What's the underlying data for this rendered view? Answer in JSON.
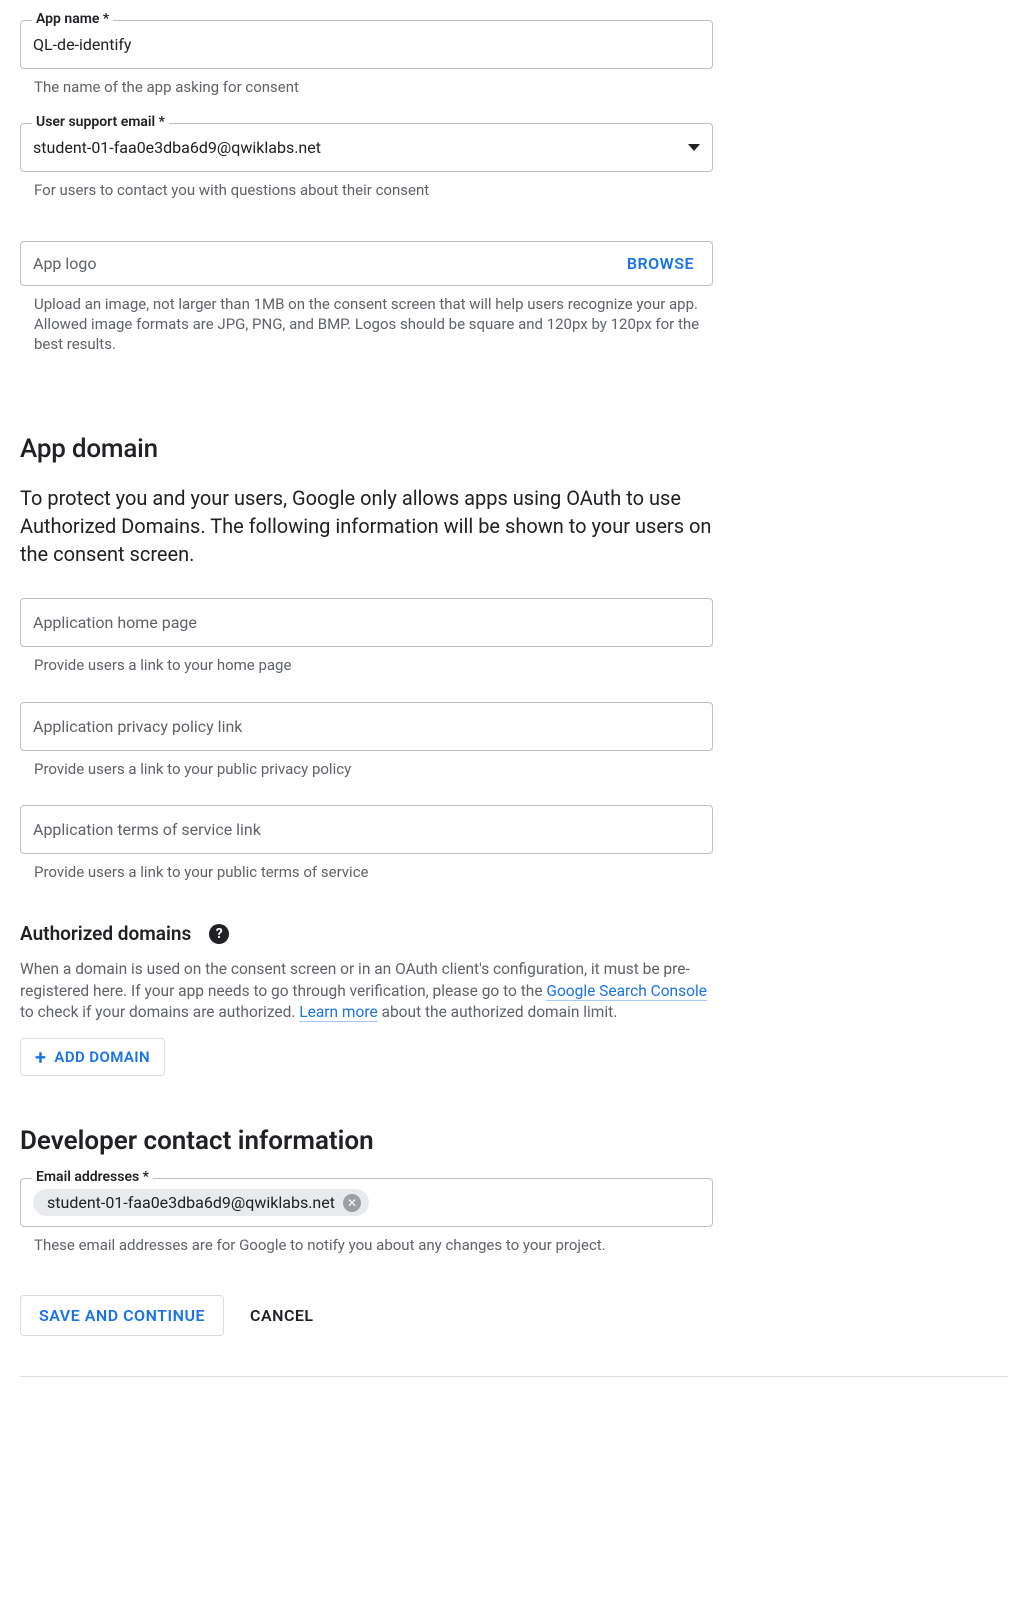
{
  "app_name": {
    "label": "App name *",
    "value": "QL-de-identify",
    "helper": "The name of the app asking for consent"
  },
  "support_email": {
    "label": "User support email *",
    "value": "student-01-faa0e3dba6d9@qwiklabs.net",
    "helper": "For users to contact you with questions about their consent"
  },
  "app_logo": {
    "placeholder": "App logo",
    "browse": "BROWSE",
    "helper": "Upload an image, not larger than 1MB on the consent screen that will help users recognize your app. Allowed image formats are JPG, PNG, and BMP. Logos should be square and 120px by 120px for the best results."
  },
  "app_domain": {
    "title": "App domain",
    "intro": "To protect you and your users, Google only allows apps using OAuth to use Authorized Domains. The following information will be shown to your users on the consent screen.",
    "home_page": {
      "placeholder": "Application home page",
      "helper": "Provide users a link to your home page"
    },
    "privacy": {
      "placeholder": "Application privacy policy link",
      "helper": "Provide users a link to your public privacy policy"
    },
    "tos": {
      "placeholder": "Application terms of service link",
      "helper": "Provide users a link to your public terms of service"
    }
  },
  "authorized_domains": {
    "title": "Authorized domains",
    "desc_pre": "When a domain is used on the consent screen or in an OAuth client's configuration, it must be pre-registered here. If your app needs to go through verification, please go to the ",
    "link1": "Google Search Console",
    "desc_mid": " to check if your domains are authorized. ",
    "link2": "Learn more",
    "desc_post": " about the authorized domain limit.",
    "add_button": "ADD DOMAIN"
  },
  "developer_contact": {
    "title": "Developer contact information",
    "label": "Email addresses *",
    "chip": "student-01-faa0e3dba6d9@qwiklabs.net",
    "helper": "These email addresses are for Google to notify you about any changes to your project."
  },
  "actions": {
    "save": "SAVE AND CONTINUE",
    "cancel": "CANCEL"
  }
}
